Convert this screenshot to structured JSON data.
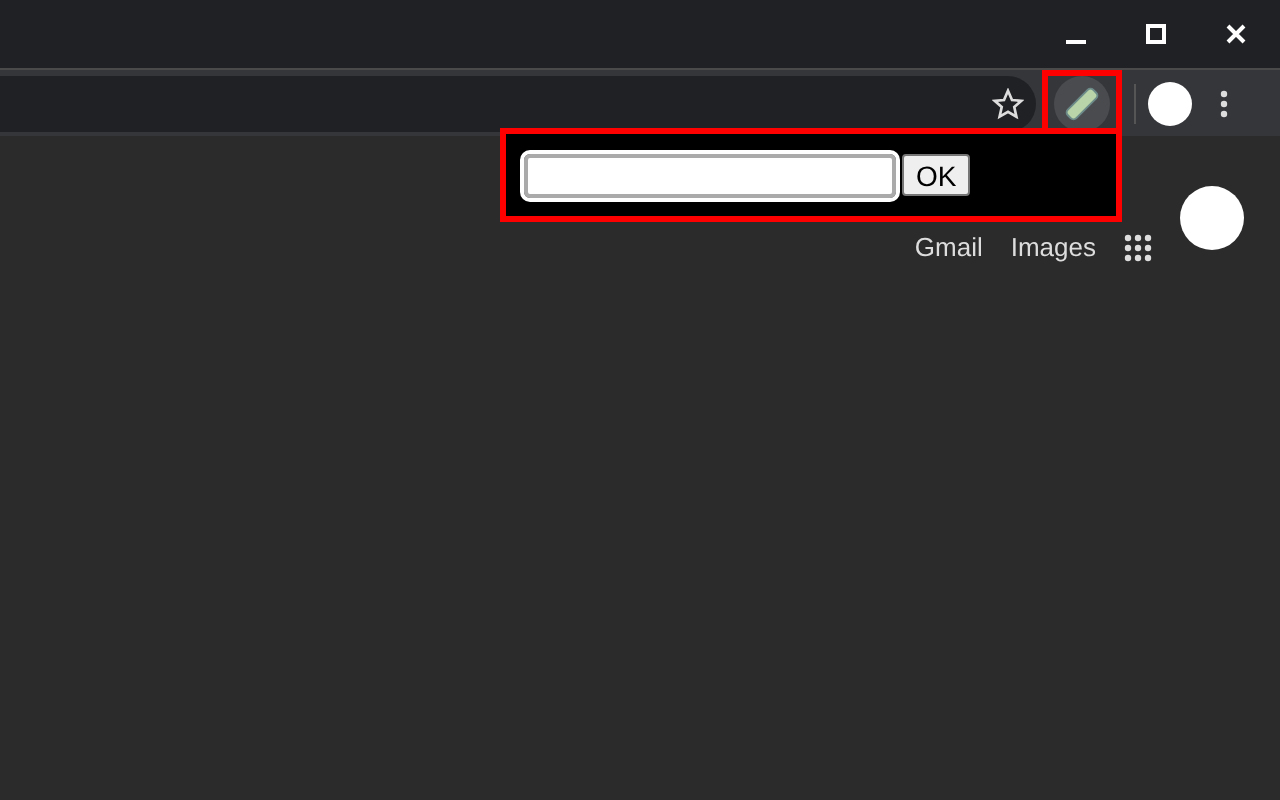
{
  "popup": {
    "button": "OK"
  },
  "page_links": [
    "Gmail",
    "Images"
  ]
}
